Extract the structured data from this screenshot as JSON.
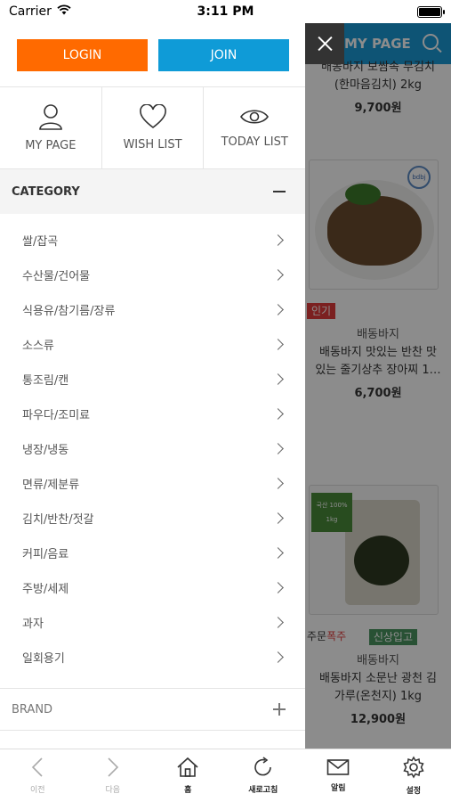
{
  "status_bar": {
    "carrier": "Carrier",
    "time": "3:11 PM",
    "battery_level": 1.0
  },
  "background": {
    "header_title": "MY PAGE",
    "products": [
      {
        "brand": "배동바지 보쌈속 무김치",
        "name": "(한마음김치) 2kg",
        "price": "9,700원"
      },
      {
        "badge": "인기",
        "brand": "배동바지",
        "name_line1": "배동바지 맛있는 반찬 맛",
        "name_line2": "있는 줄기상추 장아찌 1…",
        "price": "6,700원",
        "logo_text": "bdbj"
      },
      {
        "badge_order_prefix": "주문",
        "badge_order_highlight": "폭주",
        "badge_new": "신상입고",
        "brand": "배동바지",
        "name_line1": "배동바지 소문난 광천 김",
        "name_line2": "가루(온천지) 1kg",
        "price": "12,900원",
        "label_line1": "국산 100%",
        "label_line2": "1kg"
      }
    ]
  },
  "menu": {
    "login_label": "LOGIN",
    "join_label": "JOIN",
    "quick_links": [
      {
        "label": "MY PAGE",
        "icon": "person-icon"
      },
      {
        "label": "WISH LIST",
        "icon": "heart-icon"
      },
      {
        "label": "TODAY LIST",
        "icon": "eye-icon"
      }
    ],
    "category_title": "CATEGORY",
    "categories": [
      "쌀/잡곡",
      "수산물/건어물",
      "식용유/참기름/장류",
      "소스류",
      "통조림/캔",
      "파우다/조미료",
      "냉장/냉동",
      "면류/제분류",
      "김치/반찬/젓갈",
      "커피/음료",
      "주방/세제",
      "과자",
      "일회용기"
    ],
    "brand_title": "BRAND"
  },
  "tabbar": [
    {
      "label": "이전",
      "icon": "back-icon"
    },
    {
      "label": "다음",
      "icon": "forward-icon"
    },
    {
      "label": "홈",
      "icon": "home-icon"
    },
    {
      "label": "새로고침",
      "icon": "refresh-icon"
    },
    {
      "label": "알림",
      "icon": "mail-icon"
    },
    {
      "label": "설정",
      "icon": "settings-icon"
    }
  ]
}
